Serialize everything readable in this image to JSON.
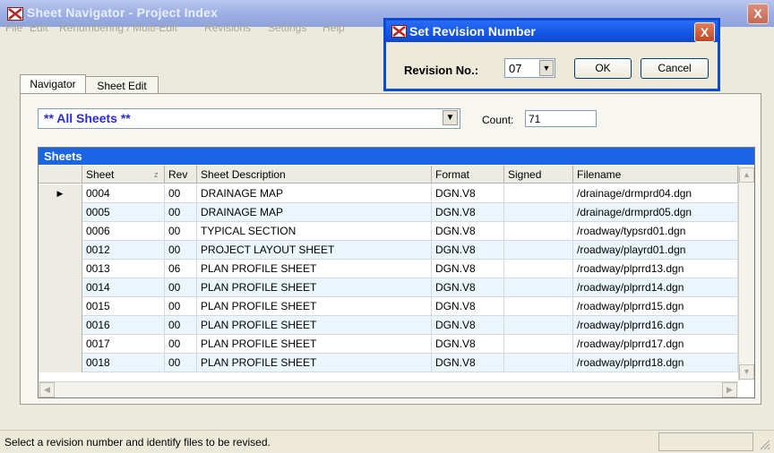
{
  "window": {
    "title": "Sheet Navigator - Project Index",
    "close_label": "X"
  },
  "menu": [
    "File",
    "Edit",
    "Renumbering / Multi-Edit",
    "Revisions",
    "Settings",
    "Help"
  ],
  "tabs": [
    {
      "label": "Navigator",
      "active": true
    },
    {
      "label": "Sheet Edit",
      "active": false
    }
  ],
  "filter": {
    "selected": "** All Sheets **",
    "count_label": "Count:",
    "count_value": "71"
  },
  "grid": {
    "title": "Sheets",
    "columns": [
      "Sheet",
      "Rev",
      "Sheet Description",
      "Format",
      "Signed",
      "Filename"
    ],
    "sort_indicator": "z",
    "current_row_marker": "▶",
    "rows": [
      {
        "sheet": "0004",
        "rev": "00",
        "desc": "DRAINAGE MAP",
        "format": "DGN.V8",
        "signed": "",
        "file": "/drainage/drmprd04.dgn"
      },
      {
        "sheet": "0005",
        "rev": "00",
        "desc": "DRAINAGE MAP",
        "format": "DGN.V8",
        "signed": "",
        "file": "/drainage/drmprd05.dgn"
      },
      {
        "sheet": "0006",
        "rev": "00",
        "desc": "TYPICAL SECTION",
        "format": "DGN.V8",
        "signed": "",
        "file": "/roadway/typsrd01.dgn"
      },
      {
        "sheet": "0012",
        "rev": "00",
        "desc": "PROJECT LAYOUT SHEET",
        "format": "DGN.V8",
        "signed": "",
        "file": "/roadway/playrd01.dgn"
      },
      {
        "sheet": "0013",
        "rev": "06",
        "desc": "PLAN PROFILE SHEET",
        "format": "DGN.V8",
        "signed": "",
        "file": "/roadway/plprrd13.dgn"
      },
      {
        "sheet": "0014",
        "rev": "00",
        "desc": "PLAN PROFILE SHEET",
        "format": "DGN.V8",
        "signed": "",
        "file": "/roadway/plprrd14.dgn"
      },
      {
        "sheet": "0015",
        "rev": "00",
        "desc": "PLAN PROFILE SHEET",
        "format": "DGN.V8",
        "signed": "",
        "file": "/roadway/plprrd15.dgn"
      },
      {
        "sheet": "0016",
        "rev": "00",
        "desc": "PLAN PROFILE SHEET",
        "format": "DGN.V8",
        "signed": "",
        "file": "/roadway/plprrd16.dgn"
      },
      {
        "sheet": "0017",
        "rev": "00",
        "desc": "PLAN PROFILE SHEET",
        "format": "DGN.V8",
        "signed": "",
        "file": "/roadway/plprrd17.dgn"
      },
      {
        "sheet": "0018",
        "rev": "00",
        "desc": "PLAN PROFILE SHEET",
        "format": "DGN.V8",
        "signed": "",
        "file": "/roadway/plprrd18.dgn"
      }
    ]
  },
  "dialog": {
    "title": "Set Revision Number",
    "label": "Revision No.:",
    "value": "07",
    "ok": "OK",
    "cancel": "Cancel",
    "close_label": "X"
  },
  "status": {
    "text": "Select a revision number and identify files to be revised."
  },
  "colors": {
    "grid_header": "#1b64e3",
    "alt_row": "#eaf6fb",
    "dialog_border": "#0a4ad8",
    "combo_text": "#2c2cd4"
  }
}
